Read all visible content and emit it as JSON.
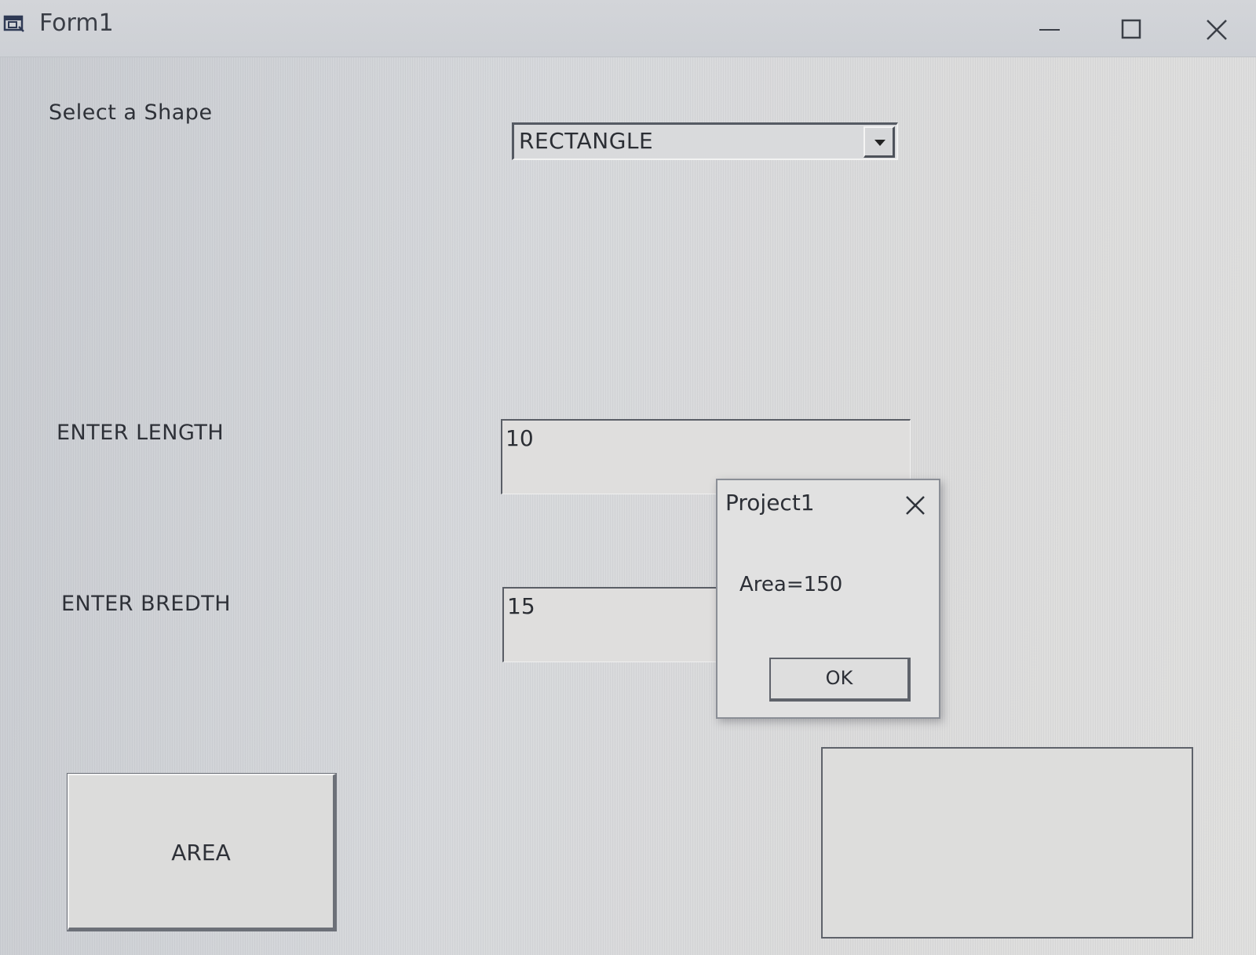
{
  "window": {
    "title": "Form1",
    "icon": "form-window-icon",
    "controls": [
      "minimize-icon",
      "maximize-icon",
      "close-icon"
    ]
  },
  "form": {
    "select_shape_label": "Select a Shape",
    "shape_combo": {
      "value": "RECTANGLE"
    },
    "length_label": "ENTER LENGTH",
    "length_value": "10",
    "bredth_label": "ENTER BREDTH",
    "bredth_value": "15",
    "area_button_label": "AREA"
  },
  "message_box": {
    "title": "Project1",
    "message": "Area=150",
    "ok_label": "OK"
  }
}
